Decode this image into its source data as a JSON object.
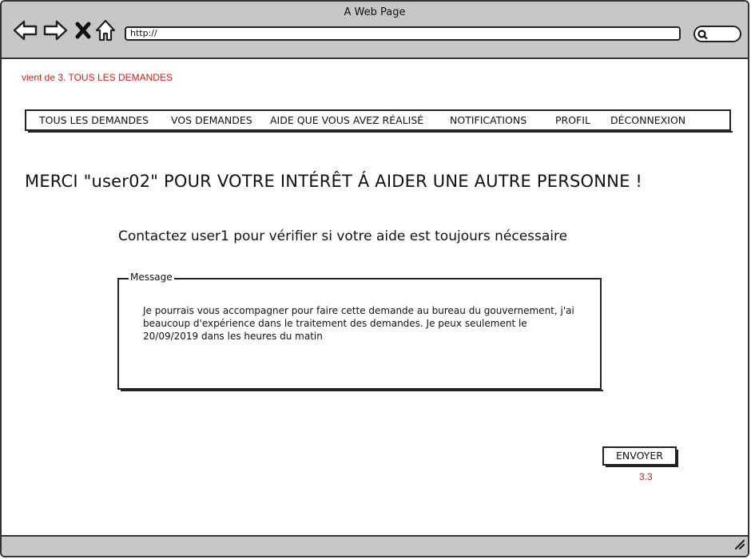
{
  "window": {
    "title": "A Web Page"
  },
  "toolbar": {
    "url": "http://",
    "icons": [
      "back-arrow-icon",
      "forward-arrow-icon",
      "close-x-icon",
      "home-icon",
      "search-icon"
    ]
  },
  "annotations": {
    "origin": "vient de 3. TOUS LES DEMANDES",
    "ref": "3.3"
  },
  "nav": {
    "items": [
      "TOUS LES DEMANDES",
      "VOS DEMANDES",
      "AIDE QUE VOUS AVEZ RÉALISÉ",
      "NOTIFICATIONS",
      "PROFIL",
      "DÉCONNEXION"
    ]
  },
  "main": {
    "heading": "MERCI \"user02\" POUR VOTRE INTÉRÊT Á AIDER UNE AUTRE PERSONNE !",
    "subheading": "Contactez user1 pour vérifier si votre aide est toujours nécessaire",
    "message": {
      "legend": "Message",
      "lines": [
        "Je pourrais vous accompagner pour faire cette demande au bureau du gouvernement, j'ai",
        "beaucoup d'expérience dans le traitement des demandes. Je peux seulement le",
        "20/09/2019 dans les heures du matin"
      ]
    },
    "send_label": "ENVOYER"
  },
  "colors": {
    "annotation": "#c4251f",
    "chrome": "#c7c7c7"
  }
}
